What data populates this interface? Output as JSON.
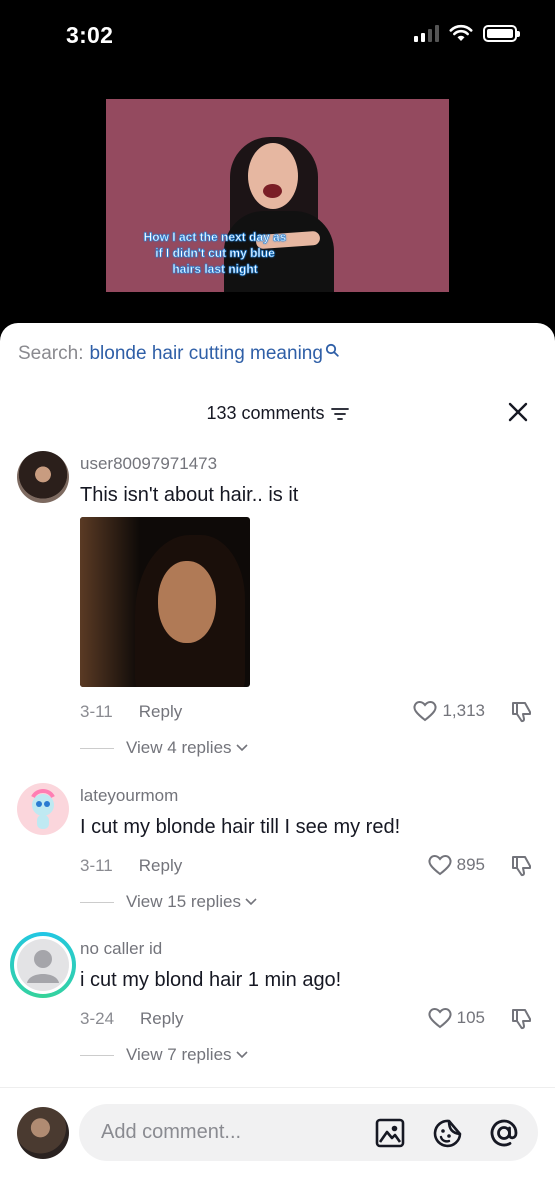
{
  "status_bar": {
    "time": "3:02"
  },
  "video": {
    "caption": "How I act the next day as if I didn't cut my blue hairs last night"
  },
  "search": {
    "prefix": "Search:",
    "term": "blonde hair cutting meaning"
  },
  "comments_header": {
    "count_label": "133 comments"
  },
  "comments": [
    {
      "username": "user80097971473",
      "text": "This isn't about hair.. is it",
      "date": "3-11",
      "reply_label": "Reply",
      "likes": "1,313",
      "view_replies": "View 4 replies",
      "has_gif": true
    },
    {
      "username": "lateyourmom",
      "text": "I cut my blonde hair till I see my red!",
      "date": "3-11",
      "reply_label": "Reply",
      "likes": "895",
      "view_replies": "View 15 replies"
    },
    {
      "username": "no caller id",
      "text": "i cut my blond hair 1 min ago!",
      "date": "3-24",
      "reply_label": "Reply",
      "likes": "105",
      "view_replies": "View 7 replies"
    }
  ],
  "composer": {
    "placeholder": "Add comment..."
  },
  "icons": [
    "signal-icon",
    "wifi-icon",
    "battery-icon",
    "search-icon",
    "sort-icon",
    "close-icon",
    "heart-icon",
    "dislike-icon",
    "chevron-down-icon",
    "image-icon",
    "emoji-icon",
    "mention-icon"
  ]
}
